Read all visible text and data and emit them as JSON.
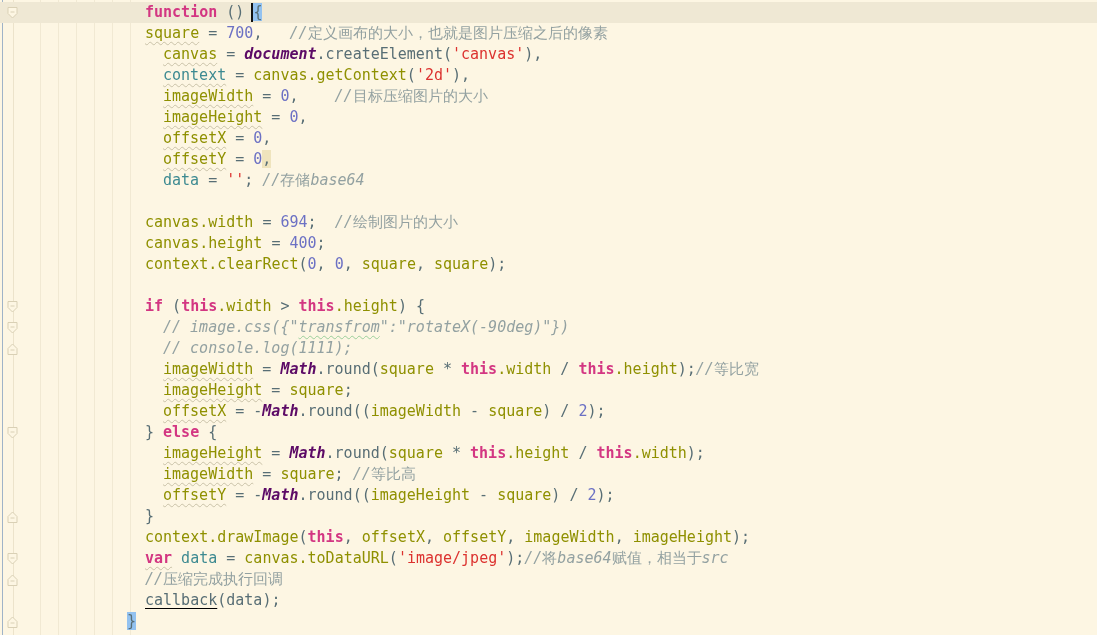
{
  "lines": [
    {
      "kind": "stmt",
      "current": true,
      "fold_start": true,
      "fold_end": false,
      "tokens": [
        {
          "text": "function",
          "kind": "kw"
        },
        {
          "text": " () ",
          "kind": "plain"
        },
        {
          "text": "{",
          "kind": "match"
        }
      ]
    },
    {
      "kind": "stmt",
      "current": false,
      "fold_start": false,
      "fold_end": false,
      "tokens": [
        {
          "text": "square",
          "kind": "idw"
        },
        {
          "text": " = ",
          "kind": "plain"
        },
        {
          "text": "700",
          "kind": "num"
        },
        {
          "text": ",   ",
          "kind": "plain"
        },
        {
          "text": "//定义画布的大小，也就是图片压缩之后的像素",
          "kind": "cmt"
        }
      ]
    },
    {
      "kind": "nested",
      "current": false,
      "fold_start": false,
      "fold_end": false,
      "tokens": [
        {
          "text": "canvas",
          "kind": "idw"
        },
        {
          "text": " = ",
          "kind": "plain"
        },
        {
          "text": "document",
          "kind": "glob"
        },
        {
          "text": ".createElement(",
          "kind": "plain"
        },
        {
          "text": "'canvas'",
          "kind": "str"
        },
        {
          "text": "),",
          "kind": "plain"
        }
      ]
    },
    {
      "kind": "nested",
      "current": false,
      "fold_start": false,
      "fold_end": false,
      "tokens": [
        {
          "text": "context",
          "kind": "varw"
        },
        {
          "text": " = ",
          "kind": "plain"
        },
        {
          "text": "canvas.getContext",
          "kind": "id"
        },
        {
          "text": "(",
          "kind": "plain"
        },
        {
          "text": "'2d'",
          "kind": "str"
        },
        {
          "text": "),",
          "kind": "plain"
        }
      ]
    },
    {
      "kind": "nested",
      "current": false,
      "fold_start": false,
      "fold_end": false,
      "tokens": [
        {
          "text": "imageWidth",
          "kind": "idw"
        },
        {
          "text": " = ",
          "kind": "plain"
        },
        {
          "text": "0",
          "kind": "num"
        },
        {
          "text": ",    ",
          "kind": "plain"
        },
        {
          "text": "//目标压缩图片的大小",
          "kind": "cmt"
        }
      ]
    },
    {
      "kind": "nested",
      "current": false,
      "fold_start": false,
      "fold_end": false,
      "tokens": [
        {
          "text": "imageHeight",
          "kind": "idw"
        },
        {
          "text": " = ",
          "kind": "plain"
        },
        {
          "text": "0",
          "kind": "num"
        },
        {
          "text": ",",
          "kind": "plain"
        }
      ]
    },
    {
      "kind": "nested",
      "current": false,
      "fold_start": false,
      "fold_end": false,
      "tokens": [
        {
          "text": "offsetX",
          "kind": "idw"
        },
        {
          "text": " = ",
          "kind": "plain"
        },
        {
          "text": "0",
          "kind": "num"
        },
        {
          "text": ",",
          "kind": "plain"
        }
      ]
    },
    {
      "kind": "nested",
      "current": false,
      "fold_start": false,
      "fold_end": false,
      "tokens": [
        {
          "text": "offsetY",
          "kind": "idw"
        },
        {
          "text": " = ",
          "kind": "plain"
        },
        {
          "text": "0",
          "kind": "num"
        },
        {
          "text": ",",
          "kind": "hl"
        }
      ]
    },
    {
      "kind": "nested",
      "current": false,
      "fold_start": false,
      "fold_end": false,
      "tokens": [
        {
          "text": "data",
          "kind": "var"
        },
        {
          "text": " = ",
          "kind": "plain"
        },
        {
          "text": "''",
          "kind": "str"
        },
        {
          "text": "; ",
          "kind": "plain"
        },
        {
          "text": "//存储base64",
          "kind": "cmt"
        }
      ]
    },
    {
      "kind": "blank",
      "current": false,
      "fold_start": false,
      "fold_end": false
    },
    {
      "kind": "stmt",
      "current": false,
      "fold_start": false,
      "fold_end": false,
      "tokens": [
        {
          "text": "canvas.width",
          "kind": "id"
        },
        {
          "text": " = ",
          "kind": "plain"
        },
        {
          "text": "694",
          "kind": "num"
        },
        {
          "text": ";  ",
          "kind": "plain"
        },
        {
          "text": "//绘制图片的大小",
          "kind": "cmt"
        }
      ]
    },
    {
      "kind": "stmt",
      "current": false,
      "fold_start": false,
      "fold_end": false,
      "tokens": [
        {
          "text": "canvas.height",
          "kind": "id"
        },
        {
          "text": " = ",
          "kind": "plain"
        },
        {
          "text": "400",
          "kind": "num"
        },
        {
          "text": ";",
          "kind": "plain"
        }
      ]
    },
    {
      "kind": "stmt",
      "current": false,
      "fold_start": false,
      "fold_end": false,
      "tokens": [
        {
          "text": "context.clearRect",
          "kind": "id"
        },
        {
          "text": "(",
          "kind": "plain"
        },
        {
          "text": "0",
          "kind": "num"
        },
        {
          "text": ", ",
          "kind": "plain"
        },
        {
          "text": "0",
          "kind": "num"
        },
        {
          "text": ", ",
          "kind": "plain"
        },
        {
          "text": "square",
          "kind": "id"
        },
        {
          "text": ", ",
          "kind": "plain"
        },
        {
          "text": "square",
          "kind": "id"
        },
        {
          "text": ");",
          "kind": "plain"
        }
      ]
    },
    {
      "kind": "blank",
      "current": false,
      "fold_start": false,
      "fold_end": false
    },
    {
      "kind": "stmt",
      "current": false,
      "fold_start": true,
      "fold_end": false,
      "tokens": [
        {
          "text": "if",
          "kind": "kw"
        },
        {
          "text": " (",
          "kind": "plain"
        },
        {
          "text": "this",
          "kind": "kw"
        },
        {
          "text": ".width",
          "kind": "id"
        },
        {
          "text": " > ",
          "kind": "plain"
        },
        {
          "text": "this",
          "kind": "kw"
        },
        {
          "text": ".height",
          "kind": "id"
        },
        {
          "text": ") {",
          "kind": "plain"
        }
      ]
    },
    {
      "kind": "nested",
      "current": false,
      "fold_start": true,
      "fold_end": false,
      "tokens": [
        {
          "text": "// image.css({\"",
          "kind": "cmt"
        },
        {
          "text": "transfrom",
          "kind": "cmtw"
        },
        {
          "text": "\":\"rotateX(-90deg)\"})",
          "kind": "cmt"
        }
      ]
    },
    {
      "kind": "nested",
      "current": false,
      "fold_start": false,
      "fold_end": true,
      "tokens": [
        {
          "text": "// console.log(1111);",
          "kind": "cmt"
        }
      ]
    },
    {
      "kind": "nested",
      "current": false,
      "fold_start": false,
      "fold_end": false,
      "tokens": [
        {
          "text": "imageWidth",
          "kind": "idw"
        },
        {
          "text": " = ",
          "kind": "plain"
        },
        {
          "text": "Math",
          "kind": "glob"
        },
        {
          "text": ".round(",
          "kind": "plain"
        },
        {
          "text": "square",
          "kind": "id"
        },
        {
          "text": " * ",
          "kind": "plain"
        },
        {
          "text": "this",
          "kind": "kw"
        },
        {
          "text": ".width",
          "kind": "id"
        },
        {
          "text": " / ",
          "kind": "plain"
        },
        {
          "text": "this",
          "kind": "kw"
        },
        {
          "text": ".height",
          "kind": "id"
        },
        {
          "text": ");",
          "kind": "plain"
        },
        {
          "text": "//等比宽",
          "kind": "cmt"
        }
      ]
    },
    {
      "kind": "nested",
      "current": false,
      "fold_start": false,
      "fold_end": false,
      "tokens": [
        {
          "text": "imageHeight",
          "kind": "idw"
        },
        {
          "text": " = ",
          "kind": "plain"
        },
        {
          "text": "square",
          "kind": "id"
        },
        {
          "text": ";",
          "kind": "plain"
        }
      ]
    },
    {
      "kind": "nested",
      "current": false,
      "fold_start": false,
      "fold_end": false,
      "tokens": [
        {
          "text": "offsetX",
          "kind": "idw"
        },
        {
          "text": " = -",
          "kind": "plain"
        },
        {
          "text": "Math",
          "kind": "glob"
        },
        {
          "text": ".round((",
          "kind": "plain"
        },
        {
          "text": "imageWidth",
          "kind": "id"
        },
        {
          "text": " - ",
          "kind": "plain"
        },
        {
          "text": "square",
          "kind": "id"
        },
        {
          "text": ") / ",
          "kind": "plain"
        },
        {
          "text": "2",
          "kind": "num"
        },
        {
          "text": ");",
          "kind": "plain"
        }
      ]
    },
    {
      "kind": "stmt",
      "current": false,
      "fold_start": true,
      "fold_end": false,
      "tokens": [
        {
          "text": "} ",
          "kind": "plain"
        },
        {
          "text": "else",
          "kind": "kw"
        },
        {
          "text": " {",
          "kind": "plain"
        }
      ]
    },
    {
      "kind": "nested",
      "current": false,
      "fold_start": false,
      "fold_end": false,
      "tokens": [
        {
          "text": "imageHeight",
          "kind": "idw"
        },
        {
          "text": " = ",
          "kind": "plain"
        },
        {
          "text": "Math",
          "kind": "glob"
        },
        {
          "text": ".round(",
          "kind": "plain"
        },
        {
          "text": "square",
          "kind": "id"
        },
        {
          "text": " * ",
          "kind": "plain"
        },
        {
          "text": "this",
          "kind": "kw"
        },
        {
          "text": ".height",
          "kind": "id"
        },
        {
          "text": " / ",
          "kind": "plain"
        },
        {
          "text": "this",
          "kind": "kw"
        },
        {
          "text": ".width",
          "kind": "id"
        },
        {
          "text": ");",
          "kind": "plain"
        }
      ]
    },
    {
      "kind": "nested",
      "current": false,
      "fold_start": false,
      "fold_end": false,
      "tokens": [
        {
          "text": "imageWidth",
          "kind": "idw"
        },
        {
          "text": " = ",
          "kind": "plain"
        },
        {
          "text": "square",
          "kind": "id"
        },
        {
          "text": "; ",
          "kind": "plain"
        },
        {
          "text": "//等比高",
          "kind": "cmt"
        }
      ]
    },
    {
      "kind": "nested",
      "current": false,
      "fold_start": false,
      "fold_end": false,
      "tokens": [
        {
          "text": "offsetY",
          "kind": "idw"
        },
        {
          "text": " = -",
          "kind": "plain"
        },
        {
          "text": "Math",
          "kind": "glob"
        },
        {
          "text": ".round((",
          "kind": "plain"
        },
        {
          "text": "imageHeight",
          "kind": "id"
        },
        {
          "text": " - ",
          "kind": "plain"
        },
        {
          "text": "square",
          "kind": "id"
        },
        {
          "text": ") / ",
          "kind": "plain"
        },
        {
          "text": "2",
          "kind": "num"
        },
        {
          "text": ");",
          "kind": "plain"
        }
      ]
    },
    {
      "kind": "stmt",
      "current": false,
      "fold_start": false,
      "fold_end": true,
      "tokens": [
        {
          "text": "}",
          "kind": "plain"
        }
      ]
    },
    {
      "kind": "stmt",
      "current": false,
      "fold_start": false,
      "fold_end": false,
      "tokens": [
        {
          "text": "context.drawImage",
          "kind": "id"
        },
        {
          "text": "(",
          "kind": "plain"
        },
        {
          "text": "this",
          "kind": "kw"
        },
        {
          "text": ", ",
          "kind": "plain"
        },
        {
          "text": "offsetX",
          "kind": "id"
        },
        {
          "text": ", ",
          "kind": "plain"
        },
        {
          "text": "offsetY",
          "kind": "id"
        },
        {
          "text": ", ",
          "kind": "plain"
        },
        {
          "text": "imageWidth",
          "kind": "id"
        },
        {
          "text": ", ",
          "kind": "plain"
        },
        {
          "text": "imageHeight",
          "kind": "id"
        },
        {
          "text": ");",
          "kind": "plain"
        }
      ]
    },
    {
      "kind": "stmt",
      "current": false,
      "fold_start": true,
      "fold_end": false,
      "tokens": [
        {
          "text": "var",
          "kind": "kww"
        },
        {
          "text": " data",
          "kind": "var"
        },
        {
          "text": " = ",
          "kind": "plain"
        },
        {
          "text": "canvas.toDataURL",
          "kind": "id"
        },
        {
          "text": "(",
          "kind": "plain"
        },
        {
          "text": "'image/jpeg'",
          "kind": "str"
        },
        {
          "text": ");",
          "kind": "plain"
        },
        {
          "text": "//将base64赋值，相当于src",
          "kind": "cmt"
        }
      ]
    },
    {
      "kind": "stmt",
      "current": false,
      "fold_start": false,
      "fold_end": true,
      "tokens": [
        {
          "text": "//压缩完成执行回调",
          "kind": "cmt"
        }
      ]
    },
    {
      "kind": "stmt",
      "current": false,
      "fold_start": false,
      "fold_end": false,
      "tokens": [
        {
          "text": "callback",
          "kind": "link"
        },
        {
          "text": "(data);",
          "kind": "plain"
        }
      ]
    },
    {
      "kind": "brace",
      "current": false,
      "fold_start": false,
      "fold_end": true,
      "tokens": [
        {
          "text": "}",
          "kind": "match"
        }
      ]
    }
  ]
}
